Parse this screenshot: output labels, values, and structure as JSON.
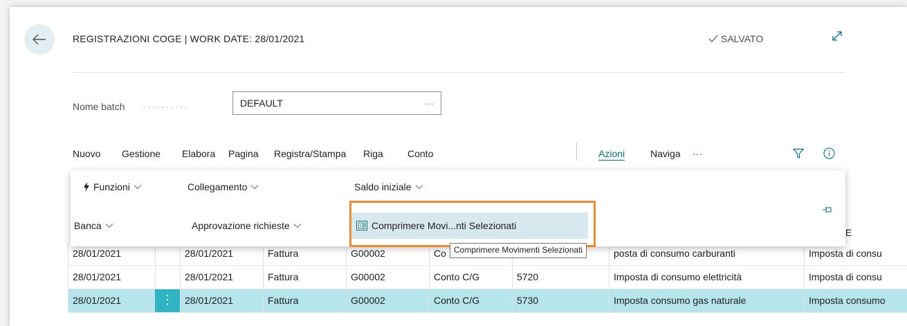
{
  "header": {
    "title": "REGISTRAZIONI COGE | WORK DATE: 28/01/2021",
    "status": "SALVATO"
  },
  "batch": {
    "label": "Nome batch",
    "dots": "··········",
    "value": "DEFAULT",
    "more": "···"
  },
  "menu": {
    "items": [
      "Nuovo",
      "Gestione",
      "Elabora",
      "Pagina",
      "Registra/Stampa",
      "Riga",
      "Conto",
      "Azioni",
      "Naviga"
    ],
    "more": "···",
    "active": "Azioni"
  },
  "dropdown": {
    "funzioni": "Funzioni",
    "collegamento": "Collegamento",
    "saldo_iniziale": "Saldo iniziale",
    "banca": "Banca",
    "approvazione": "Approvazione richieste",
    "comprimere": "Comprimere Movi...nti Selezionati"
  },
  "tooltip": "Comprimere Movimenti Selezionati",
  "column_header_partial": "RIZIONE",
  "rows": [
    {
      "date": "28/01/2021",
      "doc_date": "28/01/2021",
      "type": "Fattura",
      "doc_no": "G00002",
      "account_type": "Co",
      "account_no": "",
      "description": "posta di consumo carburanti",
      "desc2": "Imposta di consu"
    },
    {
      "date": "28/01/2021",
      "doc_date": "28/01/2021",
      "type": "Fattura",
      "doc_no": "G00002",
      "account_type": "Conto C/G",
      "account_no": "5720",
      "description": "Imposta di consumo elettricità",
      "desc2": "Imposta di consu"
    },
    {
      "date": "28/01/2021",
      "doc_date": "28/01/2021",
      "type": "Fattura",
      "doc_no": "G00002",
      "account_type": "Conto C/G",
      "account_no": "5730",
      "description": "Imposta consumo gas naturale",
      "desc2": "Imposta consumo"
    }
  ],
  "kebab": "⋮",
  "colors": {
    "accent": "#00728a",
    "selected_row": "#b7e5ec",
    "highlight_border": "#ef8a2e"
  }
}
